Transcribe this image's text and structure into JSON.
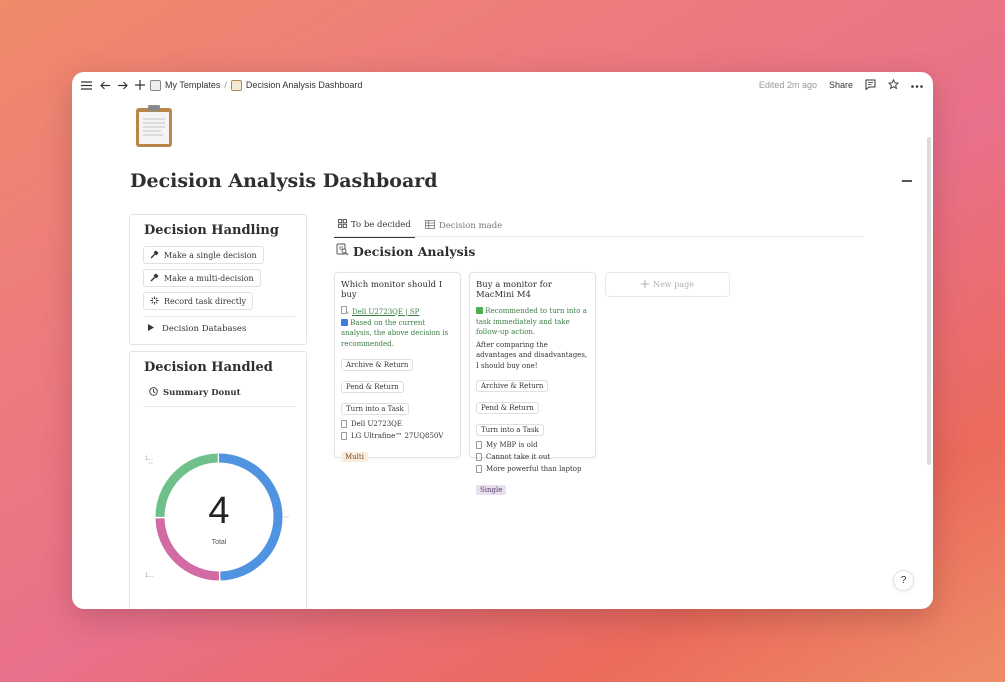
{
  "topbar": {
    "breadcrumb_parent": "My Templates",
    "separator": "/",
    "breadcrumb_current": "Decision Analysis Dashboard",
    "edited": "Edited 2m ago",
    "share": "Share"
  },
  "page": {
    "title": "Decision Analysis Dashboard"
  },
  "handling": {
    "title": "Decision Handling",
    "buttons": [
      {
        "label": "Make a single decision",
        "icon": "hammer-icon"
      },
      {
        "label": "Make a multi-decision",
        "icon": "hammer-icon"
      },
      {
        "label": "Record task directly",
        "icon": "sparkle-icon"
      }
    ],
    "toggle": "Decision Databases"
  },
  "handled": {
    "title": "Decision Handled",
    "summary_label": "Summary Donut",
    "donut_total": "4",
    "donut_caption": "Total",
    "label_top": "1...",
    "label_bottom": "1..."
  },
  "chart_data": {
    "type": "pie",
    "values": [
      2,
      1,
      1
    ],
    "colors": [
      "#5093e0",
      "#d26aa3",
      "#6fc08a"
    ],
    "total": 4
  },
  "tabs": [
    {
      "label": "To be decided",
      "active": true
    },
    {
      "label": "Decision made",
      "active": false
    }
  ],
  "database": {
    "title": "Decision Analysis"
  },
  "cards": [
    {
      "title": "Which monitor should I buy",
      "link": "Dell U2723QE | SP",
      "note": "Based on the current analysis, the above decision is recommended.",
      "chips": [
        "Archive & Return",
        "Pend & Return",
        "Turn into a Task"
      ],
      "relations": [
        "Dell U2723QE",
        "LG Ultrafine™ 27UQ850V"
      ],
      "tag": "Multi"
    },
    {
      "title": "Buy a monitor for MacMini M4",
      "note": "Recommended to turn into a task immediately and take follow-up action.",
      "body": "After comparing the advantages and disadvantages, I should buy one!",
      "chips": [
        "Archive & Return",
        "Pend & Return",
        "Turn into a Task"
      ],
      "relations": [
        "My MBP is old",
        "Cannot take it out",
        "More powerful than laptop"
      ],
      "tag": "Single"
    }
  ],
  "new_page": "New page",
  "help": "?",
  "colors": {
    "tag_multi_bg": "#fbecdd",
    "tag_single_bg": "#e8deee",
    "green_text": "#3a7d44"
  }
}
